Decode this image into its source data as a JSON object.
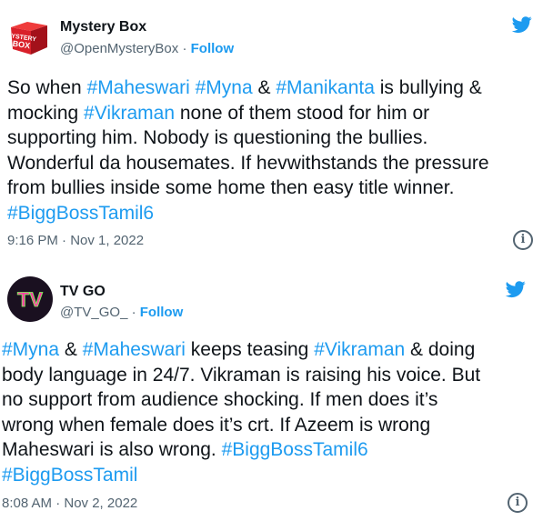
{
  "tweets": [
    {
      "author": "Mystery Box",
      "handle": "@OpenMysteryBox",
      "dot": "·",
      "follow": "Follow",
      "logo_text": "MYSTERY BOX",
      "lines": [
        [
          {
            "t": "So when "
          },
          {
            "t": "#Maheswari",
            "tag": true
          },
          {
            "t": " "
          },
          {
            "t": "#Myna",
            "tag": true
          },
          {
            "t": " & "
          },
          {
            "t": "#Manikanta",
            "tag": true
          },
          {
            "t": " is bullying &"
          }
        ],
        [
          {
            "t": "mocking "
          },
          {
            "t": "#Vikraman",
            "tag": true
          },
          {
            "t": " none of them stood for him or"
          }
        ],
        [
          {
            "t": "supporting him. Nobody is questioning the bullies."
          }
        ],
        [
          {
            "t": "Wonderful da housemates. If hevwithstands the pressure"
          }
        ],
        [
          {
            "t": "from bullies inside some home then easy title winner."
          }
        ],
        [
          {
            "t": "#BiggBossTamil6",
            "tag": true
          }
        ]
      ],
      "time": "9:16 PM · Nov 1, 2022"
    },
    {
      "author": "TV GO",
      "handle": "@TV_GO_",
      "dot": "·",
      "follow": "Follow",
      "logo_text": "TV",
      "lines": [
        [
          {
            "t": "#Myna",
            "tag": true
          },
          {
            "t": " & "
          },
          {
            "t": "#Maheswari",
            "tag": true
          },
          {
            "t": " keeps teasing "
          },
          {
            "t": "#Vikraman",
            "tag": true
          },
          {
            "t": " & doing"
          }
        ],
        [
          {
            "t": "body language in 24/7. Vikraman is raising his voice. But"
          }
        ],
        [
          {
            "t": "no support from audience shocking. If men does it’s"
          }
        ],
        [
          {
            "t": "wrong when female does it’s crt. If Azeem is wrong"
          }
        ],
        [
          {
            "t": "Maheswari is also wrong. "
          },
          {
            "t": "#BiggBossTamil6",
            "tag": true
          }
        ],
        [
          {
            "t": "#BiggBossTamil",
            "tag": true
          }
        ]
      ],
      "time": "8:08 AM · Nov 2, 2022"
    }
  ],
  "colors": {
    "link": "#1d9bf0",
    "secondary": "#536471",
    "text": "#0f1419",
    "divider": "#cfd9de",
    "box_red": "#d9202a"
  },
  "icons": {
    "bird": "twitter-bird-icon",
    "info": "info-icon"
  },
  "info_glyph": "i"
}
